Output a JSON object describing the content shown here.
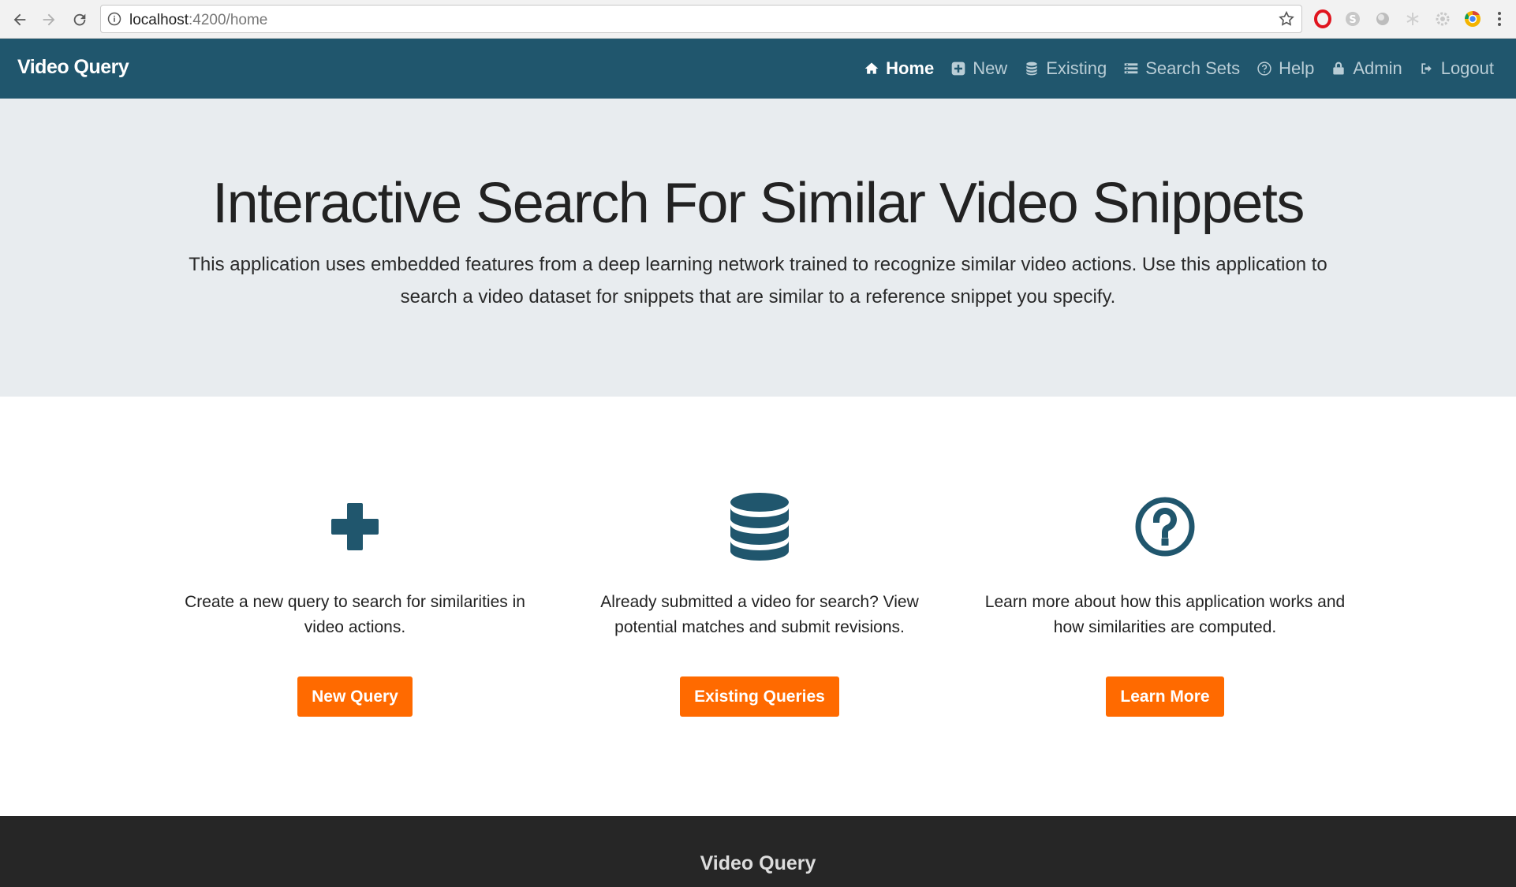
{
  "browser": {
    "url_host": "localhost",
    "url_path": ":4200/home"
  },
  "navbar": {
    "brand": "Video Query",
    "items": [
      {
        "label": "Home",
        "icon": "home-icon",
        "active": true
      },
      {
        "label": "New",
        "icon": "plus-square-icon",
        "active": false
      },
      {
        "label": "Existing",
        "icon": "database-icon",
        "active": false
      },
      {
        "label": "Search Sets",
        "icon": "list-icon",
        "active": false
      },
      {
        "label": "Help",
        "icon": "question-circle-icon",
        "active": false
      },
      {
        "label": "Admin",
        "icon": "lock-icon",
        "active": false
      },
      {
        "label": "Logout",
        "icon": "sign-out-icon",
        "active": false
      }
    ]
  },
  "jumbotron": {
    "title": "Interactive Search For Similar Video Snippets",
    "lead": "This application uses embedded features from a deep learning network trained to recognize similar video actions. Use this application to search a video dataset for snippets that are similar to a reference snippet you specify."
  },
  "features": [
    {
      "icon": "plus-icon",
      "text": "Create a new query to search for similarities in video actions.",
      "button": "New Query"
    },
    {
      "icon": "database-icon",
      "text": "Already submitted a video for search? View potential matches and submit revisions.",
      "button": "Existing Queries"
    },
    {
      "icon": "question-circle-icon",
      "text": "Learn more about how this application works and how similarities are computed.",
      "button": "Learn More"
    }
  ],
  "footer": {
    "title": "Video Query"
  },
  "colors": {
    "navbar": "#20566d",
    "accent_button": "#ff6a00",
    "jumbotron_bg": "#e8ecef",
    "footer_bg": "#262626"
  }
}
